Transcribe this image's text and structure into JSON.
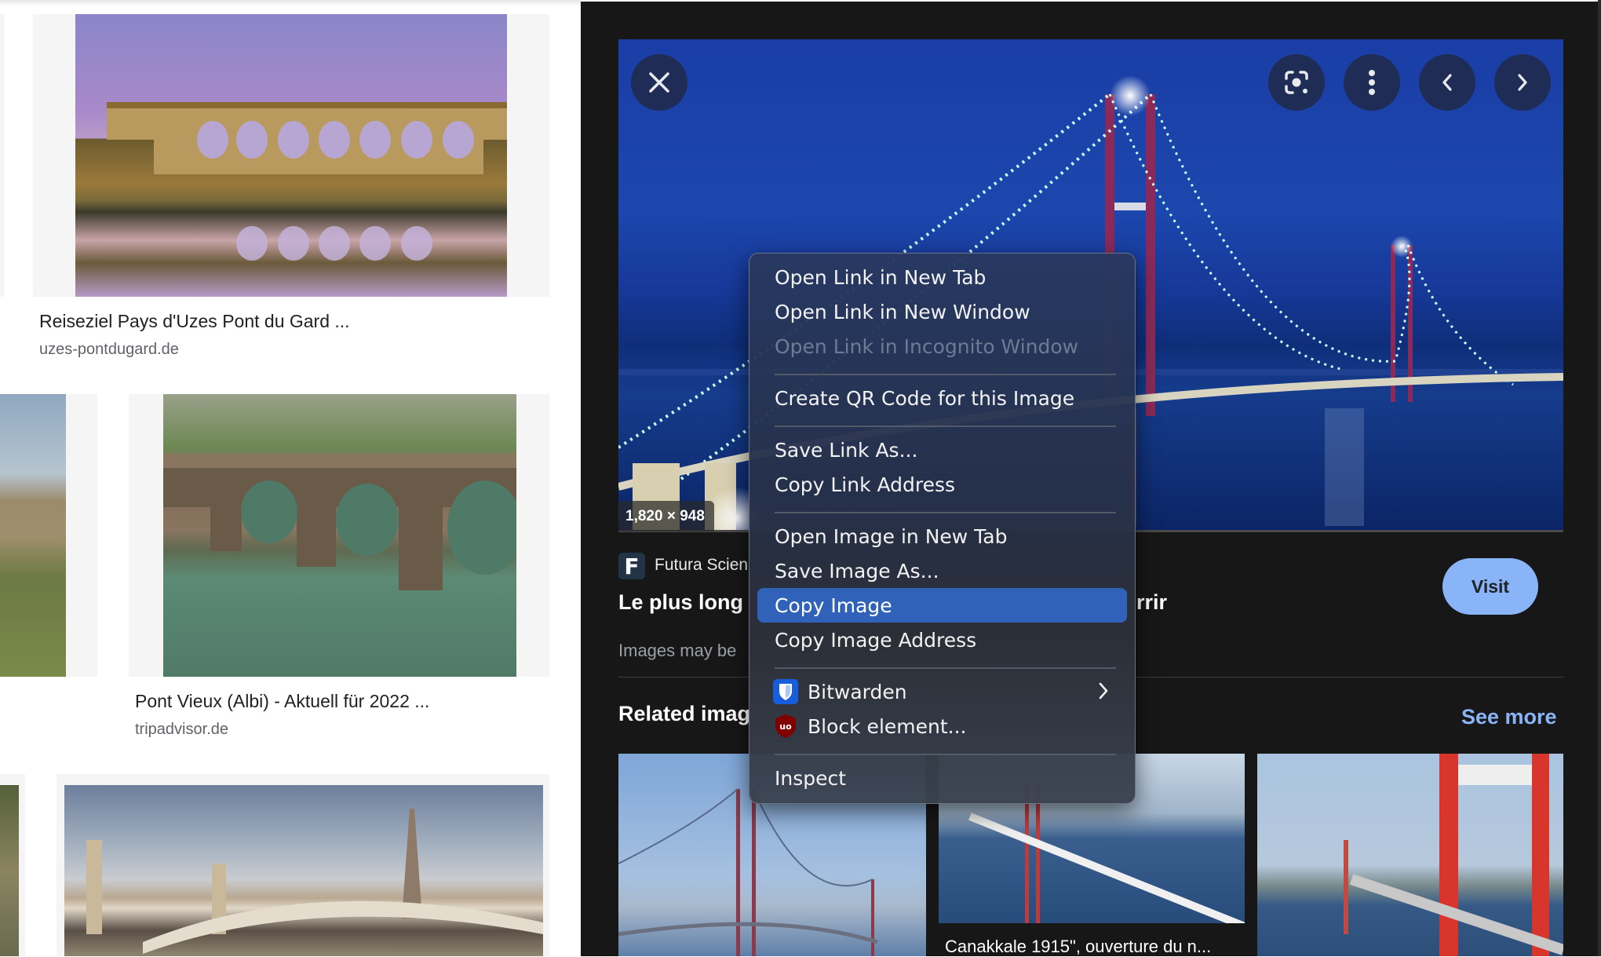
{
  "results": [
    {
      "title": "Reiseziel Pays d'Uzes Pont du Gard ...",
      "source": "uzes-pontdugard.de"
    },
    {
      "title": "Pont Vieux (Albi) - Aktuell für 2022 ...",
      "source": "tripadvisor.de"
    }
  ],
  "viewer": {
    "dimensions": "1,820 × 948",
    "source_name": "Futura Scien",
    "source_icon_letter": "F",
    "title_visible_start": "Le plus long",
    "title_visible_end": "rrir",
    "copyright_notice": "Images may be",
    "visit_label": "Visit",
    "related_title": "Related imag",
    "see_more_label": "See more",
    "buttons": {
      "close": "close-icon",
      "lens": "google-lens-icon",
      "more": "more-vert-icon",
      "prev": "chevron-left-icon",
      "next": "chevron-right-icon"
    },
    "related": [
      {
        "caption": ""
      },
      {
        "caption": "Canakkale 1915\", ouverture du n..."
      },
      {
        "caption": ""
      }
    ]
  },
  "context_menu": {
    "groups": [
      [
        {
          "label": "Open Link in New Tab",
          "enabled": true
        },
        {
          "label": "Open Link in New Window",
          "enabled": true
        },
        {
          "label": "Open Link in Incognito Window",
          "enabled": false
        }
      ],
      [
        {
          "label": "Create QR Code for this Image",
          "enabled": true
        }
      ],
      [
        {
          "label": "Save Link As...",
          "enabled": true
        },
        {
          "label": "Copy Link Address",
          "enabled": true
        }
      ],
      [
        {
          "label": "Open Image in New Tab",
          "enabled": true
        },
        {
          "label": "Save Image As...",
          "enabled": true
        },
        {
          "label": "Copy Image",
          "enabled": true,
          "highlighted": true
        },
        {
          "label": "Copy Image Address",
          "enabled": true
        }
      ],
      [
        {
          "label": "Bitwarden",
          "enabled": true,
          "icon": "bitwarden-icon",
          "submenu": true
        },
        {
          "label": "Block element...",
          "enabled": true,
          "icon": "ublock-origin-icon"
        }
      ],
      [
        {
          "label": "Inspect",
          "enabled": true
        }
      ]
    ]
  },
  "colors": {
    "panel_bg": "#171717",
    "accent": "#8ab4f8",
    "menu_highlight": "#2f62b8"
  }
}
